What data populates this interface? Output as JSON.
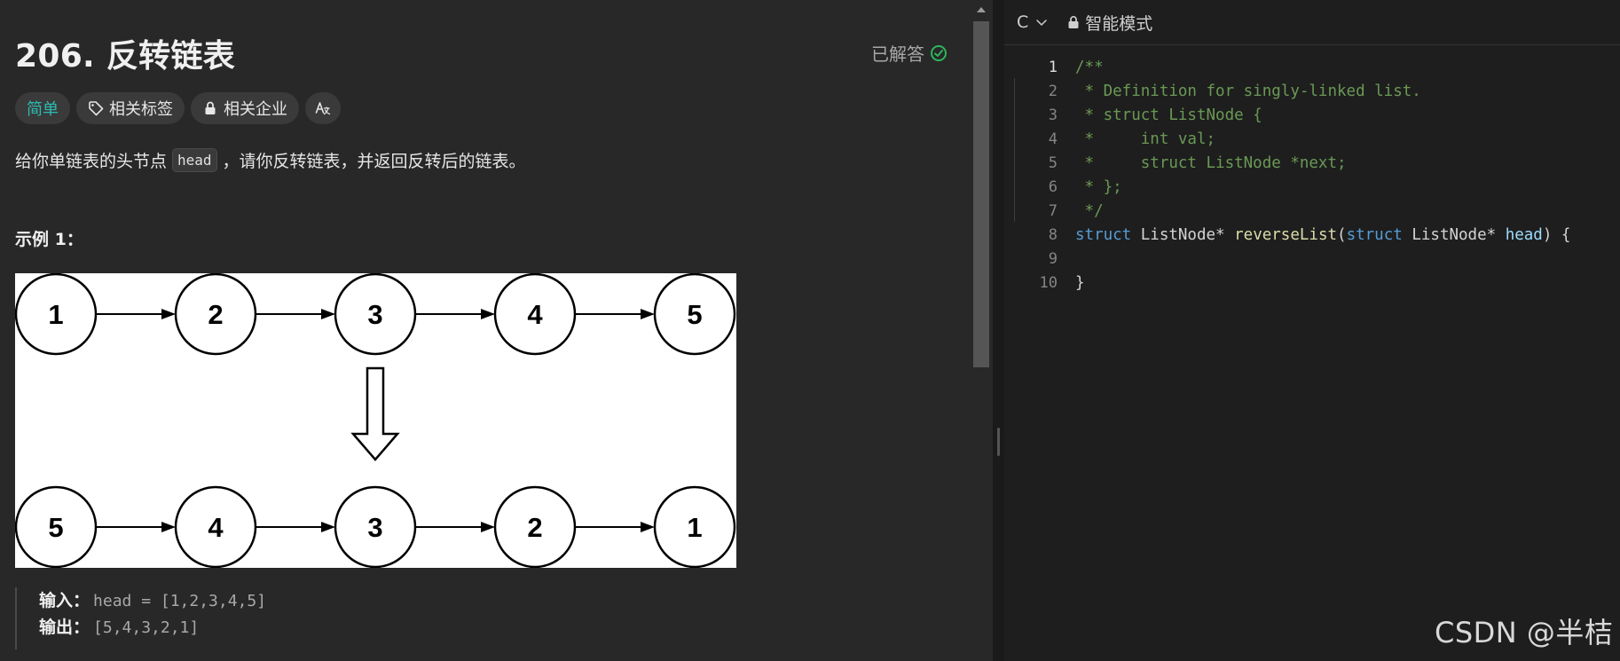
{
  "problem": {
    "title": "206. 反转链表",
    "status": "已解答",
    "tags": {
      "difficulty": "简单",
      "related_tags": "相关标签",
      "related_companies": "相关企业",
      "translate_icon_name": "translate-icon"
    },
    "description_before": "给你单链表的头节点",
    "description_code": "head",
    "description_after": "，请你反转链表，并返回反转后的链表。",
    "example_title": "示例 1：",
    "diagram": {
      "top_row": [
        "1",
        "2",
        "3",
        "4",
        "5"
      ],
      "bottom_row": [
        "5",
        "4",
        "3",
        "2",
        "1"
      ]
    },
    "input_label": "输入：",
    "input_value": "head = [1,2,3,4,5]",
    "output_label": "输出：",
    "output_value": "[5,4,3,2,1]"
  },
  "editor": {
    "language": "C",
    "mode": "智能模式",
    "line_numbers": [
      "1",
      "2",
      "3",
      "4",
      "5",
      "6",
      "7",
      "8",
      "9",
      "10"
    ],
    "lines": {
      "l1": "/**",
      "l2": " * Definition for singly-linked list.",
      "l3": " * struct ListNode {",
      "l4": " *     int val;",
      "l5": " *     struct ListNode *next;",
      "l6": " * };",
      "l7": " */",
      "l8_kw": "struct",
      "l8_type": " ListNode* ",
      "l8_fn": "reverseList",
      "l8_paren": "(",
      "l8_kw2": "struct",
      "l8_type2": " ListNode* ",
      "l8_param": "head",
      "l8_end": ") {",
      "l9": "",
      "l10": "}"
    }
  },
  "watermark": "CSDN @半桔",
  "colors": {
    "difficulty": "#2cbbb0",
    "solved_check": "#2db55d",
    "comment": "#6a9955",
    "keyword": "#569cd6",
    "function": "#dcdcaa",
    "param": "#9cdcfe"
  }
}
